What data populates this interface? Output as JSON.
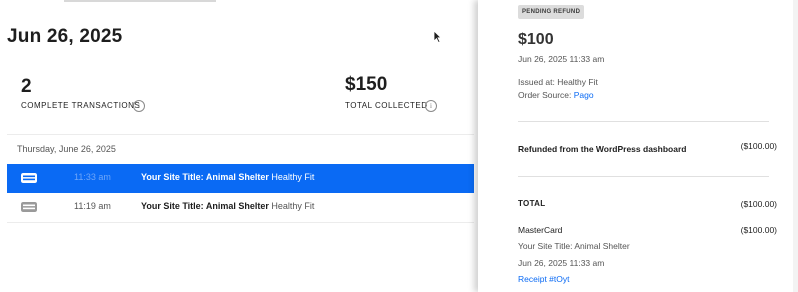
{
  "header": {
    "date": "Jun 26, 2025"
  },
  "stats": {
    "transactions": {
      "value": "2",
      "label": "COMPLETE TRANSACTIONS"
    },
    "collected": {
      "value": "$150",
      "label": "TOTAL COLLECTED"
    }
  },
  "transactions": {
    "group_date": "Thursday, June 26, 2025",
    "rows": [
      {
        "time": "11:33 am",
        "site": "Your Site Title: Animal Shelter",
        "name": "Healthy Fit",
        "selected": true
      },
      {
        "time": "11:19 am",
        "site": "Your Site Title: Animal Shelter",
        "name": "Healthy Fit",
        "selected": false
      }
    ]
  },
  "detail": {
    "status_badge": "PENDING REFUND",
    "amount": "$100",
    "datetime": "Jun 26, 2025 11:33 am",
    "issued_at": "Issued at: Healthy Fit",
    "order_source_label": "Order Source: ",
    "order_source_value": "Pago",
    "refund_line": {
      "label": "Refunded from the WordPress dashboard",
      "value": "($100.00)"
    },
    "total": {
      "label": "TOTAL",
      "value": "($100.00)"
    },
    "payment": {
      "method": "MasterCard",
      "value": "($100.00)",
      "site": "Your Site Title: Animal Shelter",
      "datetime": "Jun 26, 2025 11:33 am",
      "receipt": "Receipt #tOyt"
    }
  },
  "colors": {
    "accent": "#0a6af4",
    "badge_bg": "#dcdcdc"
  },
  "icons": {
    "card": "credit-card-icon",
    "info": "info-icon",
    "cursor": "mouse-cursor-icon"
  }
}
